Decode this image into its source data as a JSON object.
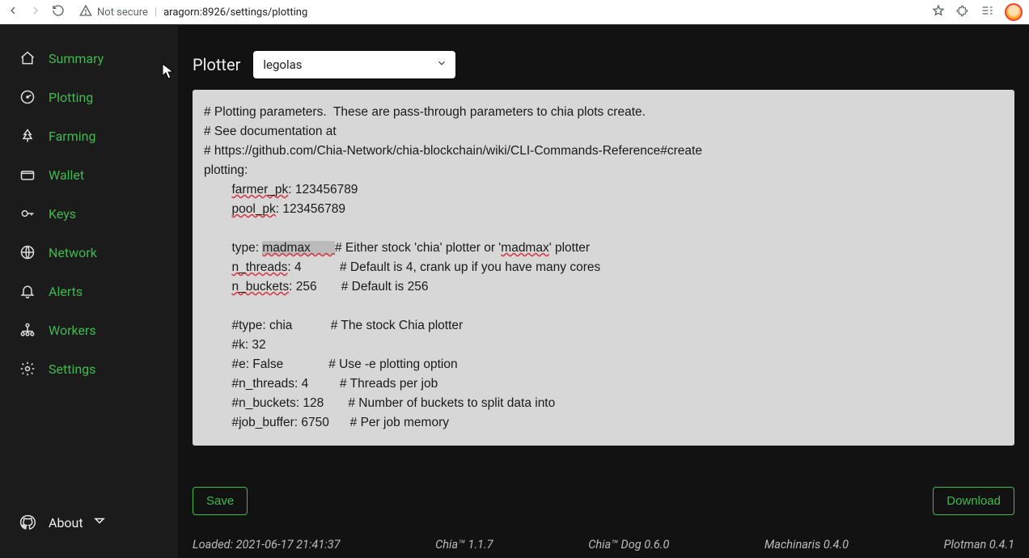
{
  "browser": {
    "not_secure_label": "Not secure",
    "url": "aragorn:8926/settings/plotting"
  },
  "sidebar": {
    "items": [
      {
        "label": "Summary",
        "icon": "home-icon"
      },
      {
        "label": "Plotting",
        "icon": "gauge-icon"
      },
      {
        "label": "Farming",
        "icon": "tree-icon"
      },
      {
        "label": "Wallet",
        "icon": "wallet-icon"
      },
      {
        "label": "Keys",
        "icon": "key-icon"
      },
      {
        "label": "Network",
        "icon": "globe-icon"
      },
      {
        "label": "Alerts",
        "icon": "bell-icon"
      },
      {
        "label": "Workers",
        "icon": "hierarchy-icon"
      },
      {
        "label": "Settings",
        "icon": "gear-icon"
      }
    ],
    "about_label": "About"
  },
  "main": {
    "plotter_label": "Plotter",
    "plotter_selected": "legolas",
    "editor": {
      "l1": "# Plotting parameters.  These are pass-through parameters to chia plots create.",
      "l2": "# See documentation at",
      "l3": "# https://github.com/Chia-Network/chia-blockchain/wiki/CLI-Commands-Reference#create",
      "l4": "plotting:",
      "farmer_pk_key": "farmer_pk",
      "farmer_pk_rest": ": 123456789",
      "pool_pk_key": "pool_pk",
      "pool_pk_rest": ": 123456789",
      "type_line_pre": "        type: ",
      "type_line_hl": "madmax       ",
      "type_line_comment_pre": "# Either stock 'chia' plotter or '",
      "type_line_comment_mm": "madmax",
      "type_line_comment_post": "' plotter",
      "nthreads_key": "n_threads",
      "nthreads_rest": ": 4           # Default is 4, crank up if you have many cores",
      "nbuckets_key": "n_buckets",
      "nbuckets_rest": ": 256       # Default is 256",
      "l12": "        #type: chia           # The stock Chia plotter",
      "l13": "        #k: 32",
      "l14": "        #e: False             # Use -e plotting option",
      "l15": "        #n_threads: 4         # Threads per job",
      "l16": "        #n_buckets: 128       # Number of buckets to split data into",
      "l17": "        #job_buffer: 6750      # Per job memory"
    },
    "save_label": "Save",
    "download_label": "Download"
  },
  "status": {
    "loaded": "Loaded: 2021-06-17 21:41:37",
    "chia": "Chia™ 1.1.7",
    "chiadog": "Chia™ Dog 0.6.0",
    "machinaris": "Machinaris 0.4.0",
    "plotman": "Plotman 0.4.1"
  }
}
